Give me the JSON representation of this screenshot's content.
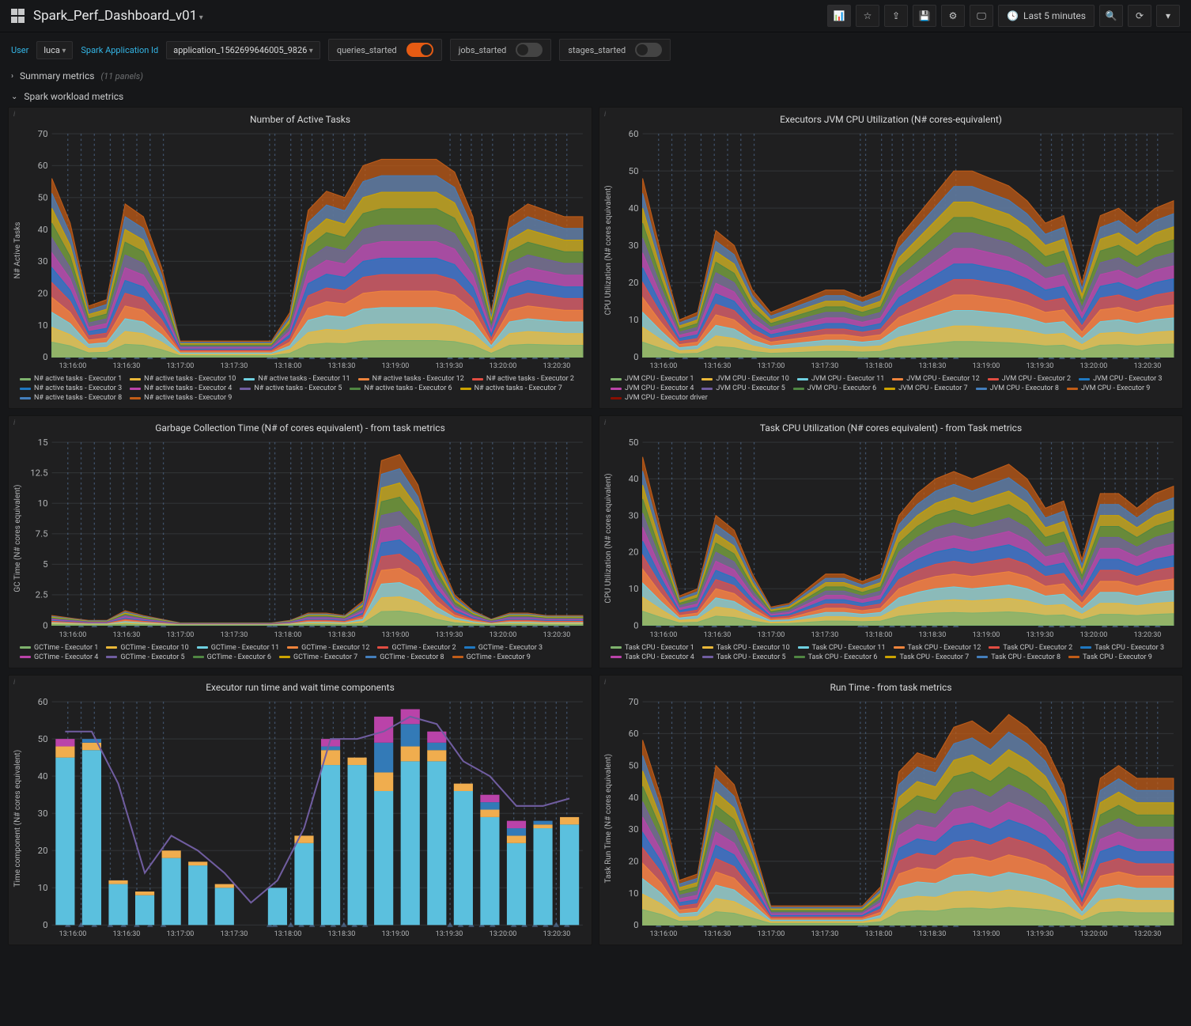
{
  "header": {
    "title": "Spark_Perf_Dashboard_v01",
    "time_range": "Last 5 minutes"
  },
  "vars": {
    "user_label": "User",
    "user_value": "luca",
    "app_label": "Spark Application Id",
    "app_value": "application_1562699646005_9826",
    "toggles": [
      {
        "label": "queries_started",
        "on": true
      },
      {
        "label": "jobs_started",
        "on": false
      },
      {
        "label": "stages_started",
        "on": false
      }
    ]
  },
  "summary_row": {
    "title": "Summary metrics",
    "count": "(11 panels)",
    "expanded": false
  },
  "workload_row": {
    "title": "Spark workload metrics",
    "expanded": true
  },
  "colors": {
    "series": [
      "#7eb26d",
      "#eab839",
      "#6ed0e0",
      "#ef843c",
      "#e24d42",
      "#1f78c1",
      "#ba43a9",
      "#705da0",
      "#508642",
      "#cca300",
      "#447ebc",
      "#c15c17",
      "#890f02"
    ]
  },
  "x_ticks": [
    "13:16:00",
    "13:16:30",
    "13:17:00",
    "13:17:30",
    "13:18:00",
    "13:18:30",
    "13:19:00",
    "13:19:30",
    "13:20:00",
    "13:20:30"
  ],
  "vlines": [
    0.03,
    0.055,
    0.08,
    0.11,
    0.135,
    0.16,
    0.185,
    0.21,
    0.41,
    0.42,
    0.45,
    0.47,
    0.49,
    0.51,
    0.53,
    0.55,
    0.57,
    0.59,
    0.75,
    0.77,
    0.79,
    0.81,
    0.83,
    0.87,
    0.89,
    0.91,
    0.93,
    0.95,
    0.97
  ],
  "panels": {
    "p1": {
      "title": "Number of Active Tasks",
      "ylabel": "N# Active Tasks",
      "legend_prefix": "N# active tasks - Executor ",
      "legend_ids": [
        "1",
        "10",
        "11",
        "12",
        "2",
        "3",
        "4",
        "5",
        "6",
        "7",
        "8",
        "9"
      ],
      "legend_extra": [],
      "y_ticks": [
        0,
        10,
        20,
        30,
        40,
        50,
        60,
        70
      ],
      "top_series": [
        56,
        42,
        16,
        18,
        48,
        44,
        28,
        5,
        5,
        5,
        5,
        5,
        5,
        14,
        46,
        52,
        50,
        60,
        62,
        62,
        62,
        62,
        58,
        44,
        14,
        44,
        48,
        46,
        44,
        44
      ]
    },
    "p2": {
      "title": "Executors JVM CPU Utilization (N# cores-equivalent)",
      "ylabel": "CPU Utilization (N# cores equivalent)",
      "legend_prefix": "JVM CPU - Executor ",
      "legend_ids": [
        "1",
        "10",
        "11",
        "12",
        "2",
        "3",
        "4",
        "5",
        "6",
        "7",
        "8",
        "9"
      ],
      "legend_extra": [
        "JVM CPU - Executor driver"
      ],
      "y_ticks": [
        0,
        10,
        20,
        30,
        40,
        50,
        60
      ],
      "top_series": [
        48,
        28,
        10,
        12,
        34,
        30,
        18,
        12,
        14,
        16,
        18,
        18,
        16,
        18,
        32,
        38,
        44,
        50,
        50,
        48,
        46,
        42,
        36,
        38,
        20,
        38,
        40,
        36,
        40,
        42
      ]
    },
    "p3": {
      "title": "Garbage Collection Time (N# of cores equivalent) - from task metrics",
      "ylabel": "GC Time (N# cores equivalent)",
      "legend_prefix": "GCTime - Executor ",
      "legend_ids": [
        "1",
        "10",
        "11",
        "12",
        "2",
        "3",
        "4",
        "5",
        "6",
        "7",
        "8",
        "9"
      ],
      "legend_extra": [],
      "y_ticks": [
        0,
        2.5,
        5.0,
        7.5,
        10.0,
        12.5,
        15.0
      ],
      "top_series": [
        0.8,
        0.6,
        0.4,
        0.4,
        1.2,
        0.8,
        0.5,
        0.2,
        0.2,
        0.2,
        0.2,
        0.2,
        0.2,
        0.4,
        1.0,
        1.0,
        0.8,
        2.0,
        13.5,
        14.0,
        11.5,
        6.0,
        2.5,
        1.2,
        0.5,
        1.0,
        1.0,
        0.8,
        0.8,
        0.8
      ]
    },
    "p4": {
      "title": "Task CPU Utilization (N# cores equivalent) - from Task metrics",
      "ylabel": "CPU Utilization (N# cores equivalent)",
      "legend_prefix": "Task CPU - Executor ",
      "legend_ids": [
        "1",
        "10",
        "11",
        "12",
        "2",
        "3",
        "4",
        "5",
        "6",
        "7",
        "8",
        "9"
      ],
      "legend_extra": [],
      "y_ticks": [
        0,
        10,
        20,
        30,
        40,
        50
      ],
      "top_series": [
        46,
        26,
        8,
        10,
        30,
        26,
        14,
        5,
        6,
        10,
        14,
        14,
        12,
        14,
        30,
        36,
        40,
        42,
        40,
        42,
        44,
        40,
        32,
        34,
        18,
        36,
        36,
        32,
        36,
        38
      ]
    },
    "p5": {
      "title": "Executor run time and wait time components",
      "ylabel": "Time component (N# cores equivalent)",
      "y_ticks": [
        0,
        10,
        20,
        30,
        40,
        50,
        60
      ],
      "bars": [
        [
          45,
          3,
          0,
          2
        ],
        [
          47,
          2,
          1,
          0
        ],
        [
          11,
          1,
          0,
          0
        ],
        [
          8,
          1,
          0,
          0
        ],
        [
          18,
          2,
          0,
          0
        ],
        [
          16,
          1,
          0,
          0
        ],
        [
          10,
          1,
          0,
          0
        ],
        [
          0,
          0,
          0,
          0
        ],
        [
          10,
          0,
          0,
          0
        ],
        [
          22,
          2,
          0,
          0
        ],
        [
          43,
          4,
          1,
          2
        ],
        [
          43,
          2,
          0,
          0
        ],
        [
          36,
          5,
          8,
          7
        ],
        [
          44,
          4,
          6,
          4
        ],
        [
          44,
          3,
          2,
          3
        ],
        [
          36,
          2,
          0,
          0
        ],
        [
          29,
          2,
          2,
          2
        ],
        [
          22,
          2,
          2,
          2
        ],
        [
          26,
          1,
          1,
          0
        ],
        [
          27,
          2,
          0,
          0
        ]
      ],
      "bar_colors": [
        "#5bc0de",
        "#f0ad4e",
        "#337ab7",
        "#ba43a9"
      ],
      "line": [
        52,
        52,
        38,
        14,
        24,
        20,
        14,
        6,
        12,
        26,
        50,
        50,
        52,
        56,
        54,
        44,
        40,
        32,
        32,
        34
      ]
    },
    "p6": {
      "title": "Run Time - from task metrics",
      "ylabel": "Task Run Time (N# cores equivalent)",
      "y_ticks": [
        0,
        10,
        20,
        30,
        40,
        50,
        60,
        70
      ],
      "top_series": [
        58,
        40,
        14,
        16,
        50,
        44,
        26,
        6,
        6,
        6,
        6,
        6,
        6,
        12,
        48,
        54,
        52,
        62,
        64,
        60,
        66,
        62,
        56,
        44,
        16,
        46,
        50,
        46,
        46,
        46
      ]
    }
  },
  "chart_data": [
    {
      "type": "area",
      "title": "Number of Active Tasks",
      "ylabel": "N# Active Tasks",
      "ylim": [
        0,
        70
      ],
      "x_labels": [
        "13:16:00",
        "13:16:30",
        "13:17:00",
        "13:17:30",
        "13:18:00",
        "13:18:30",
        "13:19:00",
        "13:19:30",
        "13:20:00",
        "13:20:30"
      ],
      "stacked": true,
      "series": [
        {
          "name": "N# active tasks - Executor 1"
        },
        {
          "name": "N# active tasks - Executor 10"
        },
        {
          "name": "N# active tasks - Executor 11"
        },
        {
          "name": "N# active tasks - Executor 12"
        },
        {
          "name": "N# active tasks - Executor 2"
        },
        {
          "name": "N# active tasks - Executor 3"
        },
        {
          "name": "N# active tasks - Executor 4"
        },
        {
          "name": "N# active tasks - Executor 5"
        },
        {
          "name": "N# active tasks - Executor 6"
        },
        {
          "name": "N# active tasks - Executor 7"
        },
        {
          "name": "N# active tasks - Executor 8"
        },
        {
          "name": "N# active tasks - Executor 9"
        }
      ],
      "stacked_total_approx": [
        56,
        42,
        16,
        18,
        48,
        44,
        28,
        5,
        5,
        5,
        5,
        5,
        5,
        14,
        46,
        52,
        50,
        60,
        62,
        62,
        62,
        62,
        58,
        44,
        14,
        44,
        48,
        46,
        44,
        44
      ]
    },
    {
      "type": "area",
      "title": "Executors JVM CPU Utilization (N# cores-equivalent)",
      "ylabel": "CPU Utilization (N# cores equivalent)",
      "ylim": [
        0,
        60
      ],
      "x_labels": [
        "13:16:00",
        "13:16:30",
        "13:17:00",
        "13:17:30",
        "13:18:00",
        "13:18:30",
        "13:19:00",
        "13:19:30",
        "13:20:00",
        "13:20:30"
      ],
      "stacked": true,
      "series": [
        {
          "name": "JVM CPU - Executor 1"
        },
        {
          "name": "JVM CPU - Executor 10"
        },
        {
          "name": "JVM CPU - Executor 11"
        },
        {
          "name": "JVM CPU - Executor 12"
        },
        {
          "name": "JVM CPU - Executor 2"
        },
        {
          "name": "JVM CPU - Executor 3"
        },
        {
          "name": "JVM CPU - Executor 4"
        },
        {
          "name": "JVM CPU - Executor 5"
        },
        {
          "name": "JVM CPU - Executor 6"
        },
        {
          "name": "JVM CPU - Executor 7"
        },
        {
          "name": "JVM CPU - Executor 8"
        },
        {
          "name": "JVM CPU - Executor 9"
        },
        {
          "name": "JVM CPU - Executor driver"
        }
      ],
      "stacked_total_approx": [
        48,
        28,
        10,
        12,
        34,
        30,
        18,
        12,
        14,
        16,
        18,
        18,
        16,
        18,
        32,
        38,
        44,
        50,
        50,
        48,
        46,
        42,
        36,
        38,
        20,
        38,
        40,
        36,
        40,
        42
      ]
    },
    {
      "type": "area",
      "title": "Garbage Collection Time (N# of cores equivalent) - from task metrics",
      "ylabel": "GC Time (N# cores equivalent)",
      "ylim": [
        0,
        15
      ],
      "x_labels": [
        "13:16:00",
        "13:16:30",
        "13:17:00",
        "13:17:30",
        "13:18:00",
        "13:18:30",
        "13:19:00",
        "13:19:30",
        "13:20:00",
        "13:20:30"
      ],
      "stacked": true,
      "series": [
        {
          "name": "GCTime - Executor 1"
        },
        {
          "name": "GCTime - Executor 10"
        },
        {
          "name": "GCTime - Executor 11"
        },
        {
          "name": "GCTime - Executor 12"
        },
        {
          "name": "GCTime - Executor 2"
        },
        {
          "name": "GCTime - Executor 3"
        },
        {
          "name": "GCTime - Executor 4"
        },
        {
          "name": "GCTime - Executor 5"
        },
        {
          "name": "GCTime - Executor 6"
        },
        {
          "name": "GCTime - Executor 7"
        },
        {
          "name": "GCTime - Executor 8"
        },
        {
          "name": "GCTime - Executor 9"
        }
      ],
      "stacked_total_approx": [
        0.8,
        0.6,
        0.4,
        0.4,
        1.2,
        0.8,
        0.5,
        0.2,
        0.2,
        0.2,
        0.2,
        0.2,
        0.2,
        0.4,
        1.0,
        1.0,
        0.8,
        2.0,
        13.5,
        14.0,
        11.5,
        6.0,
        2.5,
        1.2,
        0.5,
        1.0,
        1.0,
        0.8,
        0.8,
        0.8
      ]
    },
    {
      "type": "area",
      "title": "Task CPU Utilization (N# cores equivalent) - from Task metrics",
      "ylabel": "CPU Utilization (N# cores equivalent)",
      "ylim": [
        0,
        50
      ],
      "x_labels": [
        "13:16:00",
        "13:16:30",
        "13:17:00",
        "13:17:30",
        "13:18:00",
        "13:18:30",
        "13:19:00",
        "13:19:30",
        "13:20:00",
        "13:20:30"
      ],
      "stacked": true,
      "series": [
        {
          "name": "Task CPU - Executor 1"
        },
        {
          "name": "Task CPU - Executor 10"
        },
        {
          "name": "Task CPU - Executor 11"
        },
        {
          "name": "Task CPU - Executor 12"
        },
        {
          "name": "Task CPU - Executor 2"
        },
        {
          "name": "Task CPU - Executor 3"
        },
        {
          "name": "Task CPU - Executor 4"
        },
        {
          "name": "Task CPU - Executor 5"
        },
        {
          "name": "Task CPU - Executor 6"
        },
        {
          "name": "Task CPU - Executor 7"
        },
        {
          "name": "Task CPU - Executor 8"
        },
        {
          "name": "Task CPU - Executor 9"
        }
      ],
      "stacked_total_approx": [
        46,
        26,
        8,
        10,
        30,
        26,
        14,
        5,
        6,
        10,
        14,
        14,
        12,
        14,
        30,
        36,
        40,
        42,
        40,
        42,
        44,
        40,
        32,
        34,
        18,
        36,
        36,
        32,
        36,
        38
      ]
    },
    {
      "type": "bar",
      "title": "Executor run time and wait time components",
      "ylabel": "Time component (N# cores equivalent)",
      "ylim": [
        0,
        60
      ],
      "stacked": true,
      "x_labels": [
        "13:16:00",
        "13:16:30",
        "13:17:00",
        "13:17:30",
        "13:18:00",
        "13:18:30",
        "13:19:00",
        "13:19:30",
        "13:20:00",
        "13:20:30"
      ],
      "components_per_bar": [
        "cyan",
        "orange",
        "blue",
        "magenta"
      ],
      "values": [
        [
          45,
          3,
          0,
          2
        ],
        [
          47,
          2,
          1,
          0
        ],
        [
          11,
          1,
          0,
          0
        ],
        [
          8,
          1,
          0,
          0
        ],
        [
          18,
          2,
          0,
          0
        ],
        [
          16,
          1,
          0,
          0
        ],
        [
          10,
          1,
          0,
          0
        ],
        [
          0,
          0,
          0,
          0
        ],
        [
          10,
          0,
          0,
          0
        ],
        [
          22,
          2,
          0,
          0
        ],
        [
          43,
          4,
          1,
          2
        ],
        [
          43,
          2,
          0,
          0
        ],
        [
          36,
          5,
          8,
          7
        ],
        [
          44,
          4,
          6,
          4
        ],
        [
          44,
          3,
          2,
          3
        ],
        [
          36,
          2,
          0,
          0
        ],
        [
          29,
          2,
          2,
          2
        ],
        [
          22,
          2,
          2,
          2
        ],
        [
          26,
          1,
          1,
          0
        ],
        [
          27,
          2,
          0,
          0
        ]
      ],
      "overlay_line_approx": [
        52,
        52,
        38,
        14,
        24,
        20,
        14,
        6,
        12,
        26,
        50,
        50,
        52,
        56,
        54,
        44,
        40,
        32,
        32,
        34
      ]
    },
    {
      "type": "area",
      "title": "Run Time - from task metrics",
      "ylabel": "Task Run Time (N# cores equivalent)",
      "ylim": [
        0,
        70
      ],
      "x_labels": [
        "13:16:00",
        "13:16:30",
        "13:17:00",
        "13:17:30",
        "13:18:00",
        "13:18:30",
        "13:19:00",
        "13:19:30",
        "13:20:00",
        "13:20:30"
      ],
      "stacked": true,
      "stacked_total_approx": [
        58,
        40,
        14,
        16,
        50,
        44,
        26,
        6,
        6,
        6,
        6,
        6,
        6,
        12,
        48,
        54,
        52,
        62,
        64,
        60,
        66,
        62,
        56,
        44,
        16,
        46,
        50,
        46,
        46,
        46
      ]
    }
  ]
}
